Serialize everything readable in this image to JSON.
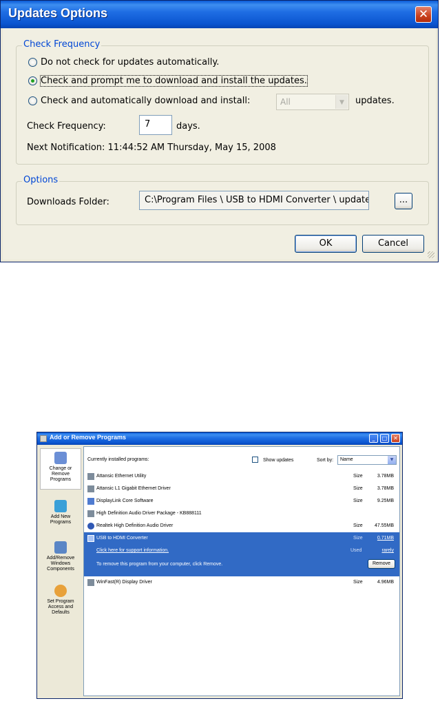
{
  "updates_dialog": {
    "title": "Updates Options",
    "close_glyph": "✕",
    "check_group": {
      "legend": "Check Frequency",
      "options": [
        {
          "label": "Do not check for updates automatically.",
          "selected": false
        },
        {
          "label": "Check and prompt me to download and install the updates.",
          "selected": true
        },
        {
          "label": "Check and automatically download and install:",
          "selected": false
        }
      ],
      "install_select_value": "All",
      "updates_suffix": "updates.",
      "frequency_label": "Check Frequency:",
      "frequency_value": "7",
      "days_label": "days.",
      "next_notification": "Next Notification: 11:44:52 AM Thursday, May 15, 2008"
    },
    "options_group": {
      "legend": "Options",
      "downloads_label": "Downloads Folder:",
      "downloads_value": "C:\\Program Files \\  USB to HDMI Converter \\ updates",
      "browse_label": "..."
    },
    "ok_label": "OK",
    "cancel_label": "Cancel"
  },
  "arp_window": {
    "title": "Add or Remove Programs",
    "window_buttons": {
      "minimize": "_",
      "maximize": "□",
      "close": "✕"
    },
    "left_panel": [
      {
        "label": "Change or Remove Programs",
        "icon": "change-remove-icon",
        "color": "#6b8fd6",
        "selected": true
      },
      {
        "label": "Add New Programs",
        "icon": "add-new-icon",
        "color": "#3aa0d8",
        "selected": false
      },
      {
        "label": "Add/Remove Windows Components",
        "icon": "windows-components-icon",
        "color": "#5a86c6",
        "selected": false
      },
      {
        "label": "Set Program Access and Defaults",
        "icon": "program-defaults-icon",
        "color": "#e8a13a",
        "selected": false
      }
    ],
    "header": {
      "currently_installed": "Currently installed programs:",
      "show_updates": "Show updates",
      "sort_by": "Sort by:",
      "sort_value": "Name"
    },
    "programs": [
      {
        "name": "Attansic Ethernet Utility",
        "size_label": "Size",
        "size": "3.78MB",
        "icon": "program-icon"
      },
      {
        "name": "Attansic L1 Gigabit Ethernet Driver",
        "size_label": "Size",
        "size": "3.78MB",
        "icon": "program-icon"
      },
      {
        "name": "DisplayLink Core Software",
        "size_label": "Size",
        "size": "9.25MB",
        "icon": "monitor-icon"
      },
      {
        "name": "High Definition Audio Driver Package - KB888111",
        "size_label": "",
        "size": "",
        "icon": "program-icon"
      },
      {
        "name": "Realtek High Definition Audio Driver",
        "size_label": "Size",
        "size": "47.55MB",
        "icon": "audio-icon"
      }
    ],
    "selected_program": {
      "name": "USB to HDMI Converter",
      "size_label": "Size",
      "size": "0.71MB",
      "support_link": "Click here for support information.",
      "used_label": "Used",
      "used_value": "rarely",
      "remove_text": "To remove this program from your computer, click Remove.",
      "remove_button": "Remove"
    },
    "last_program": {
      "name": "WinFast(R) Display Driver",
      "size_label": "Size",
      "size": "4.96MB",
      "icon": "program-icon"
    }
  }
}
